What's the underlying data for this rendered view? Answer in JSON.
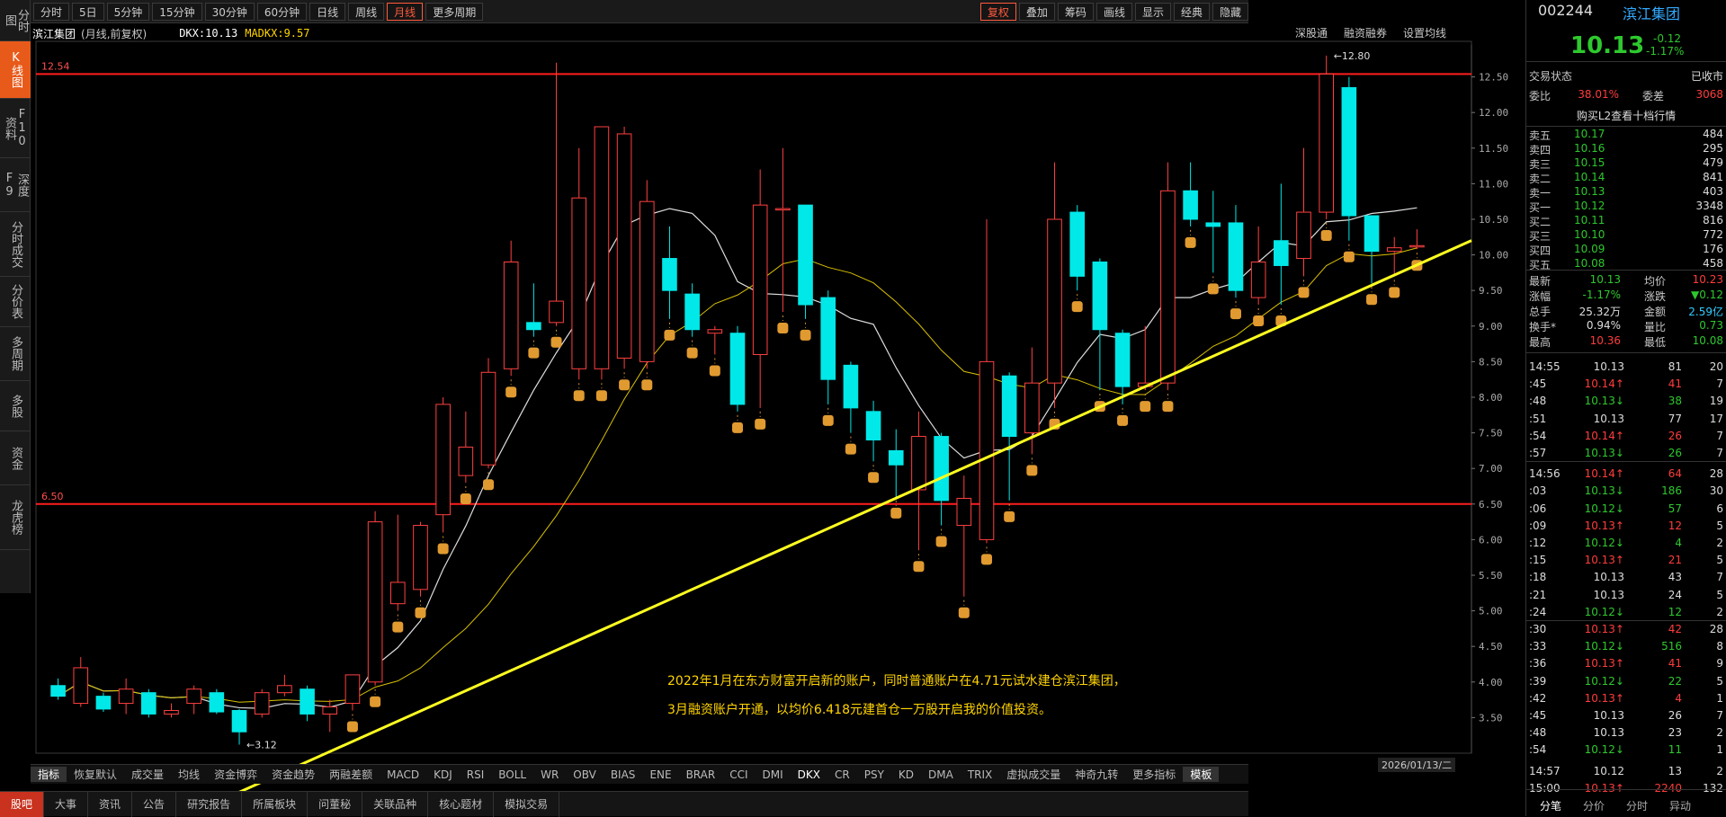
{
  "topbar": {
    "items": [
      "分时",
      "5日",
      "5分钟",
      "15分钟",
      "30分钟",
      "60分钟",
      "日线",
      "周线",
      "月线",
      "更多周期"
    ],
    "active": "月线",
    "right": [
      "复权",
      "叠加",
      "筹码",
      "画线",
      "显示",
      "经典",
      "隐藏"
    ]
  },
  "left_tabs": [
    "分时图",
    "K线图",
    "F10资料",
    "深度F9",
    "分时成交",
    "分价表",
    "多周期",
    "多股",
    "资金",
    "龙虎榜"
  ],
  "chart_header": {
    "name": "滨江集团",
    "mode": "(月线,前复权)",
    "dkx": "DKX:10.13",
    "madkx": "MADKX:9.57",
    "right_links": [
      "深股通",
      "融资融券",
      "设置均线"
    ]
  },
  "annotation": [
    "2022年1月在东方财富开启新的账户，同时普通账户在4.71元试水建仓滨江集团，",
    "3月融资账户开通，以均价6.418元建首仓一万股开启我的价值投资。"
  ],
  "date_label": "2026/01/13/二",
  "price_labels": {
    "h1": "12.54",
    "h2": "6.50",
    "max": "12.80",
    "min": "3.12"
  },
  "indicators": [
    "指标",
    "恢复默认",
    "成交量",
    "均线",
    "资金博弈",
    "资金趋势",
    "两融差额",
    "MACD",
    "KDJ",
    "RSI",
    "BOLL",
    "WR",
    "OBV",
    "BIAS",
    "ENE",
    "BRAR",
    "CCI",
    "DMI",
    "DKX",
    "CR",
    "PSY",
    "KD",
    "DMA",
    "TRIX",
    "虚拟成交量",
    "神奇九转",
    "更多指标",
    "模板"
  ],
  "bottom_tabs": [
    "股吧",
    "大事",
    "资讯",
    "公告",
    "研究报告",
    "所属板块",
    "问董秘",
    "关联品种",
    "核心题材",
    "模拟交易"
  ],
  "quote": {
    "code": "002244",
    "name": "滨江集团",
    "price": "10.13",
    "change": "-0.12",
    "pct": "-1.17%",
    "status_label": "交易状态",
    "status": "已收市",
    "wb_label": "委比",
    "wb": "38.01%",
    "wc_label": "委差",
    "wc": "3068",
    "l2": "购买L2查看十档行情",
    "asks": [
      [
        "卖五",
        "10.17",
        "484"
      ],
      [
        "卖四",
        "10.16",
        "295"
      ],
      [
        "卖三",
        "10.15",
        "479"
      ],
      [
        "卖二",
        "10.14",
        "841"
      ],
      [
        "卖一",
        "10.13",
        "403"
      ]
    ],
    "bids": [
      [
        "买一",
        "10.12",
        "3348"
      ],
      [
        "买二",
        "10.11",
        "816"
      ],
      [
        "买三",
        "10.10",
        "772"
      ],
      [
        "买四",
        "10.09",
        "176"
      ],
      [
        "买五",
        "10.08",
        "458"
      ]
    ],
    "stats": [
      [
        "最新",
        "10.13",
        "均价",
        "10.23"
      ],
      [
        "涨幅",
        "-1.17%",
        "涨跌",
        "▼0.12"
      ],
      [
        "总手",
        "25.32万",
        "金额",
        "2.59亿"
      ],
      [
        "换手*",
        "0.94%",
        "量比",
        "0.73"
      ],
      [
        "最高",
        "10.36",
        "最低",
        "10.08"
      ]
    ],
    "ticks": [
      [
        "14:55",
        "10.13",
        "81",
        "20"
      ],
      [
        ":45",
        "10.14↑",
        "41",
        "7"
      ],
      [
        ":48",
        "10.13↓",
        "38",
        "19"
      ],
      [
        ":51",
        "10.13",
        "77",
        "17"
      ],
      [
        ":54",
        "10.14↑",
        "26",
        "7"
      ],
      [
        ":57",
        "10.13↓",
        "26",
        "7"
      ],
      [
        "14:56",
        "10.14↑",
        "64",
        "28"
      ],
      [
        ":03",
        "10.13↓",
        "186",
        "30"
      ],
      [
        ":06",
        "10.12↓",
        "57",
        "6"
      ],
      [
        ":09",
        "10.13↑",
        "12",
        "5"
      ],
      [
        ":12",
        "10.12↓",
        "4",
        "2"
      ],
      [
        ":15",
        "10.13↑",
        "21",
        "5"
      ],
      [
        ":18",
        "10.13",
        "43",
        "7"
      ],
      [
        ":21",
        "10.13",
        "24",
        "5"
      ],
      [
        ":24",
        "10.12↓",
        "12",
        "2"
      ],
      [
        ":30",
        "10.13↑",
        "42",
        "28"
      ],
      [
        ":33",
        "10.12↓",
        "516",
        "8"
      ],
      [
        ":36",
        "10.13↑",
        "41",
        "9"
      ],
      [
        ":39",
        "10.12↓",
        "22",
        "5"
      ],
      [
        ":42",
        "10.13↑",
        "4",
        "1"
      ],
      [
        ":45",
        "10.13",
        "26",
        "7"
      ],
      [
        ":48",
        "10.13",
        "23",
        "2"
      ],
      [
        ":54",
        "10.12↓",
        "11",
        "1"
      ],
      [
        "14:57",
        "10.12",
        "13",
        "2"
      ],
      [
        "15:00",
        "10.13↑",
        "2240",
        "132"
      ]
    ],
    "bottom_tabs": [
      "分笔",
      "分价",
      "分时",
      "异动"
    ]
  },
  "chart_data": {
    "type": "candlestick",
    "ylim": [
      3.0,
      12.8
    ],
    "yticks": [
      "12.50",
      "12.00",
      "11.50",
      "11.00",
      "10.50",
      "10.00",
      "9.50",
      "9.00",
      "8.50",
      "8.00",
      "7.50",
      "7.00",
      "6.50",
      "6.00",
      "5.50",
      "5.00",
      "4.50",
      "4.00",
      "3.50"
    ],
    "candles": [
      [
        3.95,
        3.8,
        4.05,
        3.75
      ],
      [
        3.7,
        4.2,
        4.35,
        3.65
      ],
      [
        3.8,
        3.62,
        3.85,
        3.58
      ],
      [
        3.7,
        3.9,
        4.05,
        3.55
      ],
      [
        3.85,
        3.55,
        3.9,
        3.5
      ],
      [
        3.55,
        3.6,
        3.7,
        3.5
      ],
      [
        3.7,
        3.9,
        3.95,
        3.55
      ],
      [
        3.85,
        3.58,
        3.9,
        3.55
      ],
      [
        3.6,
        3.3,
        3.62,
        3.12
      ],
      [
        3.55,
        3.85,
        3.9,
        3.5
      ],
      [
        3.85,
        3.95,
        4.1,
        3.8
      ],
      [
        3.9,
        3.55,
        3.95,
        3.45
      ],
      [
        3.55,
        3.65,
        3.75,
        3.3
      ],
      [
        3.7,
        4.1,
        4.1,
        3.6
      ],
      [
        4.0,
        6.25,
        6.4,
        3.95
      ],
      [
        5.1,
        5.4,
        6.35,
        5.0
      ],
      [
        5.3,
        6.2,
        6.25,
        5.2
      ],
      [
        6.35,
        7.9,
        8.0,
        6.1
      ],
      [
        6.9,
        7.3,
        7.8,
        6.8
      ],
      [
        7.05,
        8.35,
        8.55,
        7.0
      ],
      [
        8.4,
        9.9,
        10.2,
        8.3
      ],
      [
        9.05,
        8.95,
        9.6,
        8.85
      ],
      [
        9.05,
        9.35,
        12.7,
        9.0
      ],
      [
        8.4,
        10.8,
        11.5,
        8.25
      ],
      [
        8.4,
        11.8,
        11.5,
        8.25
      ],
      [
        8.55,
        11.7,
        11.8,
        8.4
      ],
      [
        8.5,
        10.75,
        11.05,
        8.4
      ],
      [
        9.95,
        9.5,
        10.4,
        9.1
      ],
      [
        9.45,
        8.95,
        9.6,
        8.85
      ],
      [
        8.9,
        8.95,
        9.0,
        8.6
      ],
      [
        8.9,
        7.9,
        9.0,
        7.8
      ],
      [
        8.6,
        10.7,
        11.2,
        7.85
      ],
      [
        10.65,
        10.65,
        11.5,
        9.2
      ],
      [
        10.7,
        9.3,
        10.6,
        9.1
      ],
      [
        9.4,
        8.25,
        9.5,
        7.9
      ],
      [
        8.45,
        7.85,
        8.5,
        7.5
      ],
      [
        7.8,
        7.4,
        7.95,
        7.1
      ],
      [
        7.25,
        7.05,
        7.55,
        6.6
      ],
      [
        6.7,
        7.45,
        7.8,
        5.85
      ],
      [
        7.45,
        6.55,
        7.5,
        6.2
      ],
      [
        6.2,
        6.58,
        6.9,
        5.2
      ],
      [
        6.0,
        8.5,
        10.5,
        5.95
      ],
      [
        8.3,
        7.45,
        8.35,
        6.55
      ],
      [
        7.5,
        8.2,
        8.7,
        7.2
      ],
      [
        8.2,
        10.5,
        11.3,
        7.85
      ],
      [
        10.6,
        9.7,
        10.7,
        9.5
      ],
      [
        9.9,
        8.95,
        9.95,
        8.1
      ],
      [
        8.9,
        8.15,
        8.95,
        7.9
      ],
      [
        8.15,
        8.2,
        9.0,
        8.1
      ],
      [
        8.2,
        10.9,
        11.3,
        8.1
      ],
      [
        10.9,
        10.5,
        11.3,
        10.4
      ],
      [
        10.45,
        10.4,
        10.9,
        9.75
      ],
      [
        10.45,
        9.5,
        10.7,
        9.4
      ],
      [
        9.4,
        9.9,
        10.4,
        9.3
      ],
      [
        10.2,
        9.85,
        11.0,
        9.3
      ],
      [
        9.95,
        10.6,
        11.5,
        9.7
      ],
      [
        10.6,
        12.54,
        12.8,
        10.5
      ],
      [
        12.35,
        10.55,
        12.5,
        10.2
      ],
      [
        10.55,
        10.05,
        10.5,
        9.6
      ],
      [
        10.05,
        10.1,
        10.25,
        9.7
      ],
      [
        10.13,
        10.13,
        10.36,
        10.08
      ]
    ],
    "support_line": [
      [
        0,
        3.0
      ],
      [
        60,
        10.05
      ]
    ],
    "hlines": [
      12.54,
      6.5
    ]
  }
}
